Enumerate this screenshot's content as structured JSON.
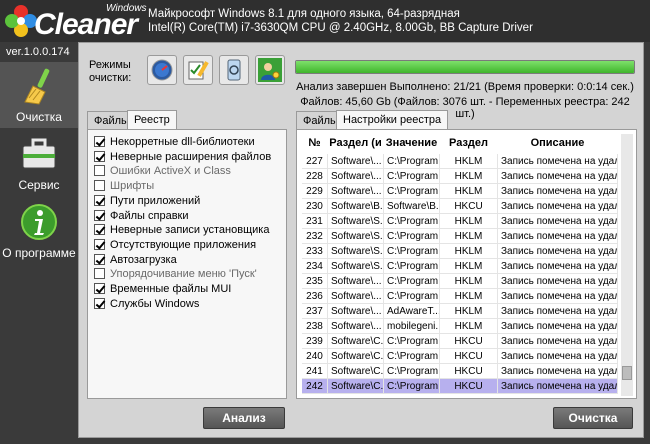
{
  "app": {
    "logo_small": "Windows",
    "logo_text": "Cleaner",
    "version": "ver.1.0.0.174"
  },
  "sysinfo": {
    "line1": "Майкрософт Windows 8.1 для одного языка, 64-разрядная",
    "line2": "Intel(R) Core(TM) i7-3630QM CPU @ 2.40GHz, 8.00Gb, BB Capture Driver"
  },
  "sidebar": {
    "items": [
      {
        "label": "Очистка",
        "icon": "broom-icon",
        "active": true
      },
      {
        "label": "Сервис",
        "icon": "toolbox-icon",
        "active": false
      },
      {
        "label": "О программе",
        "icon": "info-icon",
        "active": false
      }
    ]
  },
  "modes": {
    "label": "Режимы очистки:",
    "buttons": [
      "speedometer-icon",
      "checklist-icon",
      "phone-clean-icon",
      "user-settings-icon"
    ]
  },
  "progress": {
    "percent": 100,
    "color": "#3fb52b"
  },
  "status": {
    "line1": "Анализ завершен Выполнено: 21/21 (Время проверки: 0:0:14 сек.)",
    "line2": "Файлов: 45,60 Gb (Файлов: 3076 шт. - Переменных реестра: 242 шт.)"
  },
  "left_tabs": [
    "Файлы",
    "Реестр"
  ],
  "right_tabs": [
    "Файлы",
    "Настройки реестра"
  ],
  "registry_options": [
    {
      "label": "Некорретные dll-библиотеки",
      "checked": true
    },
    {
      "label": "Неверные расширения файлов",
      "checked": true
    },
    {
      "label": "Ошибки ActiveX и Class",
      "checked": false
    },
    {
      "label": "Шрифты",
      "checked": false
    },
    {
      "label": "Пути приложений",
      "checked": true
    },
    {
      "label": "Файлы справки",
      "checked": true
    },
    {
      "label": "Неверные записи установщика",
      "checked": true
    },
    {
      "label": "Отсутствующие приложения",
      "checked": true
    },
    {
      "label": "Автозагрузка",
      "checked": true
    },
    {
      "label": "Упорядочивание меню 'Пуск'",
      "checked": false
    },
    {
      "label": "Временные файлы MUI",
      "checked": true
    },
    {
      "label": "Службы Windows",
      "checked": true
    }
  ],
  "grid": {
    "headers": [
      "№",
      "Раздел (и",
      "Значение",
      "Раздел",
      "Описание"
    ],
    "rows": [
      [
        "227",
        "Software\\...",
        "C:\\Program ...",
        "HKLM",
        "Запись помечена на удале..."
      ],
      [
        "228",
        "Software\\...",
        "C:\\Program ...",
        "HKLM",
        "Запись помечена на удале..."
      ],
      [
        "229",
        "Software\\...",
        "C:\\Program ...",
        "HKLM",
        "Запись помечена на удале..."
      ],
      [
        "230",
        "Software\\B...",
        "Software\\B...",
        "HKCU",
        "Запись помечена на удале..."
      ],
      [
        "231",
        "Software\\S...",
        "C:\\Program ...",
        "HKLM",
        "Запись помечена на удале..."
      ],
      [
        "232",
        "Software\\S...",
        "C:\\Program ...",
        "HKLM",
        "Запись помечена на удале..."
      ],
      [
        "233",
        "Software\\S...",
        "C:\\Program ...",
        "HKLM",
        "Запись помечена на удале..."
      ],
      [
        "234",
        "Software\\S...",
        "C:\\Program ...",
        "HKLM",
        "Запись помечена на удале..."
      ],
      [
        "235",
        "Software\\...",
        "C:\\Program ...",
        "HKLM",
        "Запись помечена на удале..."
      ],
      [
        "236",
        "Software\\...",
        "C:\\Program ...",
        "HKLM",
        "Запись помечена на удале..."
      ],
      [
        "237",
        "Software\\...",
        "AdAwareT...",
        "HKLM",
        "Запись помечена на удале..."
      ],
      [
        "238",
        "Software\\...",
        "mobilegeni...",
        "HKLM",
        "Запись помечена на удале..."
      ],
      [
        "239",
        "Software\\C...",
        "C:\\Program ...",
        "HKCU",
        "Запись помечена на удале..."
      ],
      [
        "240",
        "Software\\C...",
        "C:\\Program ...",
        "HKCU",
        "Запись помечена на удале..."
      ],
      [
        "241",
        "Software\\C...",
        "C:\\Program ...",
        "HKCU",
        "Запись помечена на удале..."
      ],
      [
        "242",
        "Software\\C...",
        "C:\\Program ...",
        "HKCU",
        "Запись помечена на удале..."
      ]
    ],
    "selected_row": 15
  },
  "buttons": {
    "analyze": "Анализ",
    "clean": "Очистка"
  }
}
